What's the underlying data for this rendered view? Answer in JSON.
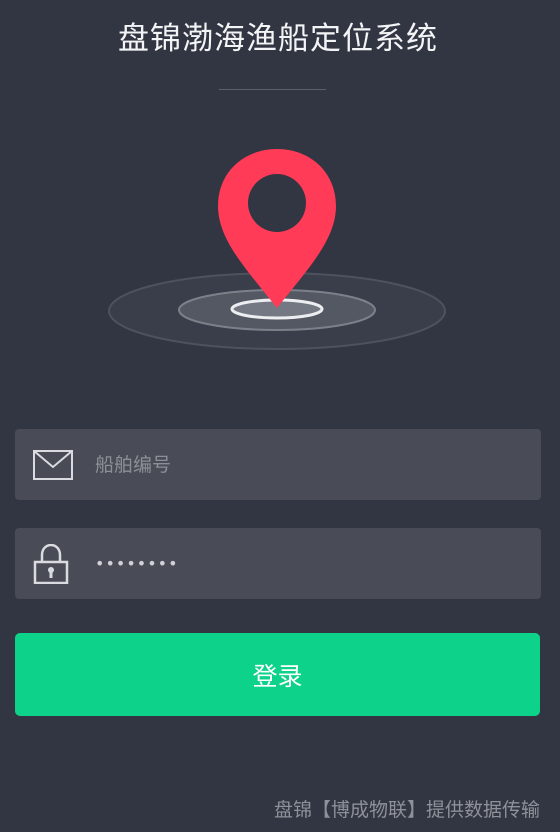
{
  "header": {
    "title": "盘锦渤海渔船定位系统"
  },
  "form": {
    "ship_number_placeholder": "船舶编号",
    "password_value": "12345678",
    "login_label": "登录"
  },
  "footer": {
    "text": "盘锦【博成物联】提供数据传输"
  },
  "icons": {
    "location": "location-pin-icon",
    "email": "envelope-icon",
    "password": "padlock-icon"
  },
  "colors": {
    "background": "#323642",
    "field_background": "#494c56",
    "accent": "#0cd28a",
    "pin": "#ff3b57"
  }
}
